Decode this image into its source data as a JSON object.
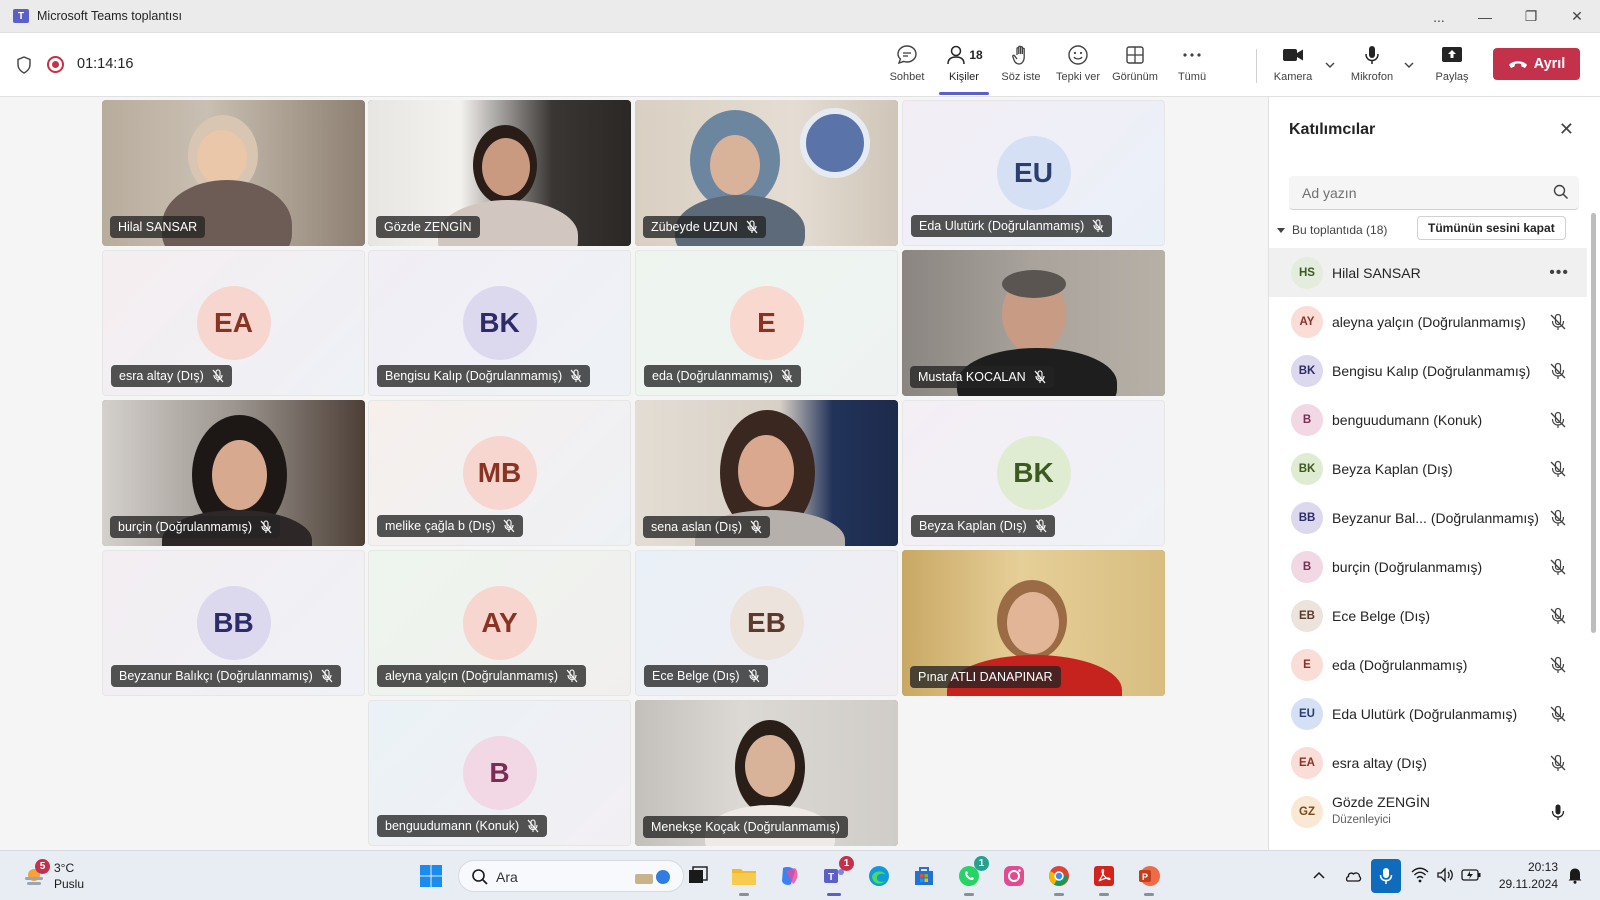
{
  "window": {
    "title": "Microsoft Teams toplantısı",
    "controls": [
      "...",
      "—",
      "❐",
      "✕"
    ]
  },
  "meeting": {
    "timer": "01:14:16"
  },
  "toolbar": {
    "chat": "Sohbet",
    "people": "Kişiler",
    "people_count": "18",
    "raise_hand": "Söz iste",
    "react": "Tepki ver",
    "view": "Görünüm",
    "more": "Tümü",
    "camera": "Kamera",
    "mic": "Mikrofon",
    "share": "Paylaş",
    "leave": "Ayrıl"
  },
  "tiles": [
    {
      "name": "Hilal SANSAR",
      "type": "video",
      "muted": false
    },
    {
      "name": "Gözde ZENGİN",
      "type": "video",
      "muted": false
    },
    {
      "name": "Zübeyde UZUN",
      "type": "video",
      "muted": true
    },
    {
      "name": "Eda Ulutürk (Doğrulanmamış)",
      "type": "avatar",
      "initials": "EU",
      "muted": true
    },
    {
      "name": "esra altay (Dış)",
      "type": "avatar",
      "initials": "EA",
      "muted": true
    },
    {
      "name": "Bengisu Kalıp (Doğrulanmamış)",
      "type": "avatar",
      "initials": "BK",
      "muted": true
    },
    {
      "name": "eda (Doğrulanmamış)",
      "type": "avatar",
      "initials": "E",
      "muted": true
    },
    {
      "name": "Mustafa KOCALAN",
      "type": "video",
      "muted": true
    },
    {
      "name": "burçin (Doğrulanmamış)",
      "type": "video",
      "muted": true
    },
    {
      "name": "melike çağla b (Dış)",
      "type": "avatar",
      "initials": "MB",
      "muted": true
    },
    {
      "name": "sena aslan (Dış)",
      "type": "video",
      "muted": true
    },
    {
      "name": "Beyza Kaplan (Dış)",
      "type": "avatar",
      "initials": "BK",
      "muted": true
    },
    {
      "name": "Beyzanur Balıkçı (Doğrulanmamış)",
      "type": "avatar",
      "initials": "BB",
      "muted": true
    },
    {
      "name": "aleyna yalçın (Doğrulanmamış)",
      "type": "avatar",
      "initials": "AY",
      "muted": true
    },
    {
      "name": "Ece Belge (Dış)",
      "type": "avatar",
      "initials": "EB",
      "muted": true
    },
    {
      "name": "Pınar ATLI DANAPINAR",
      "type": "video",
      "muted": false
    },
    {
      "name": "benguudumann (Konuk)",
      "type": "avatar",
      "initials": "B",
      "muted": true
    },
    {
      "name": "Menekşe Koçak (Doğrulanmamış)",
      "type": "video",
      "muted": false
    }
  ],
  "panel": {
    "title": "Katılımcılar",
    "search_placeholder": "Ad yazın",
    "section_label": "Bu toplantıda (18)",
    "mute_all": "Tümünün sesini kapat",
    "participants": [
      {
        "initials": "HS",
        "name": "Hilal SANSAR",
        "mic": "more"
      },
      {
        "initials": "AY",
        "name": "aleyna yalçın (Doğrulanmamış)",
        "mic": "muted"
      },
      {
        "initials": "BK",
        "name": "Bengisu Kalıp (Doğrulanmamış)",
        "mic": "muted"
      },
      {
        "initials": "B",
        "name": "benguudumann (Konuk)",
        "mic": "muted"
      },
      {
        "initials": "BK",
        "name": "Beyza Kaplan (Dış)",
        "mic": "muted"
      },
      {
        "initials": "BB",
        "name": "Beyzanur Bal... (Doğrulanmamış)",
        "mic": "muted"
      },
      {
        "initials": "B",
        "name": "burçin (Doğrulanmamış)",
        "mic": "muted"
      },
      {
        "initials": "EB",
        "name": "Ece Belge (Dış)",
        "mic": "muted"
      },
      {
        "initials": "E",
        "name": "eda (Doğrulanmamış)",
        "mic": "muted"
      },
      {
        "initials": "EU",
        "name": "Eda Ulutürk (Doğrulanmamış)",
        "mic": "muted"
      },
      {
        "initials": "EA",
        "name": "esra altay (Dış)",
        "mic": "muted"
      },
      {
        "initials": "GZ",
        "name": "Gözde ZENGİN",
        "role": "Düzenleyici",
        "mic": "on"
      }
    ]
  },
  "taskbar": {
    "weather_badge": "5",
    "weather_temp": "3°C",
    "weather_cond": "Puslu",
    "search_text": "Ara",
    "teams_badge": "1",
    "whatsapp_badge": "1",
    "time": "20:13",
    "date": "29.11.2024"
  },
  "colors": {
    "accent": "#5b5fc7",
    "leave": "#c4314b"
  }
}
